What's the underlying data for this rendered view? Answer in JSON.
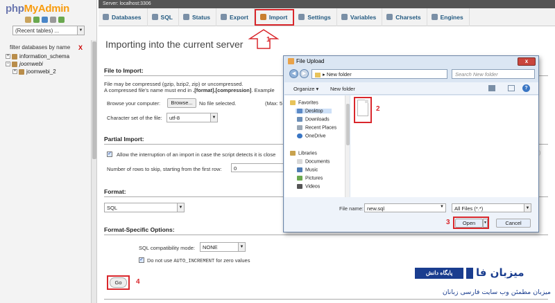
{
  "left_panel": {
    "logo_main": "php",
    "logo_accent": "MyAdmin",
    "recent_tables": "(Recent tables) ...",
    "filter_label": "filter databases by name",
    "filter_clear": "X",
    "databases": [
      "information_schema",
      "joomwebi",
      "joomwebi_2"
    ]
  },
  "server_bar": "Server: localhost:3306",
  "tabs": [
    "Databases",
    "SQL",
    "Status",
    "Export",
    "Import",
    "Settings",
    "Variables",
    "Charsets",
    "Engines"
  ],
  "page_title": "Importing into the current server",
  "file_to_import": {
    "heading": "File to Import:",
    "note1": "File may be compressed (gzip, bzip2, zip) or uncompressed.",
    "note2_prefix": "A compressed file's name must end in ",
    "note2_bold": ".[format].[compression]",
    "note2_suffix": ". Example",
    "browse_label": "Browse your computer:",
    "browse_button": "Browse...",
    "no_file": "No file selected.",
    "max": "(Max: 5",
    "charset_label": "Character set of the file:",
    "charset_value": "utf-8"
  },
  "partial_import": {
    "heading": "Partial Import:",
    "interrupt_label": "Allow the interruption of an import in case the script detects it is close",
    "skip_label": "Number of rows to skip, starting from the first row:",
    "skip_value": "0"
  },
  "format": {
    "heading": "Format:",
    "value": "SQL"
  },
  "format_specific": {
    "heading": "Format-Specific Options:",
    "compat_label": "SQL compatibility mode:",
    "compat_value": "NONE",
    "auto_inc_prefix": "Do not use ",
    "auto_inc_code": "AUTO_INCREMENT",
    "auto_inc_suffix": " for zero values"
  },
  "go_button": "Go",
  "annotations": [
    "1",
    "2",
    "3",
    "4"
  ],
  "dialog": {
    "title": "File Upload",
    "address": "New folder",
    "search_placeholder": "Search New folder",
    "organize": "Organize",
    "new_folder": "New folder",
    "favorites": [
      "Favorites",
      "Desktop",
      "Downloads",
      "Recent Places",
      "OneDrive"
    ],
    "libraries": [
      "Libraries",
      "Documents",
      "Music",
      "Pictures",
      "Videos"
    ],
    "file_name_label": "File name:",
    "file_name_value": "new.sql",
    "file_type": "All Files (*.*)",
    "open_button": "Open",
    "cancel_button": "Cancel",
    "close_glyph": "x"
  },
  "watermark": {
    "brand": "میزبان فا",
    "badge": "پایگاه دانش",
    "tagline": "میزبان مطمئن وب سایت فارسی زبانان"
  },
  "colors": {
    "accent_red": "#d9262b",
    "link_blue": "#235a81",
    "brand_blue": "#1a3d8f"
  }
}
